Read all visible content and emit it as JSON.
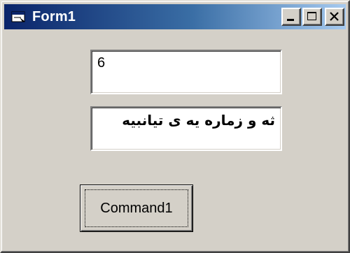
{
  "window": {
    "title": "Form1",
    "icon": "form-window-icon",
    "titlebar_colors": [
      "#0a246a",
      "#a6caf0"
    ]
  },
  "title_buttons": {
    "minimize": "minimize-icon",
    "maximize": "maximize-icon",
    "close": "close-icon"
  },
  "text1": {
    "value": "6"
  },
  "text2": {
    "value": "ثه و زماره يه ى تيانبيه"
  },
  "command1": {
    "label": "Command1"
  }
}
